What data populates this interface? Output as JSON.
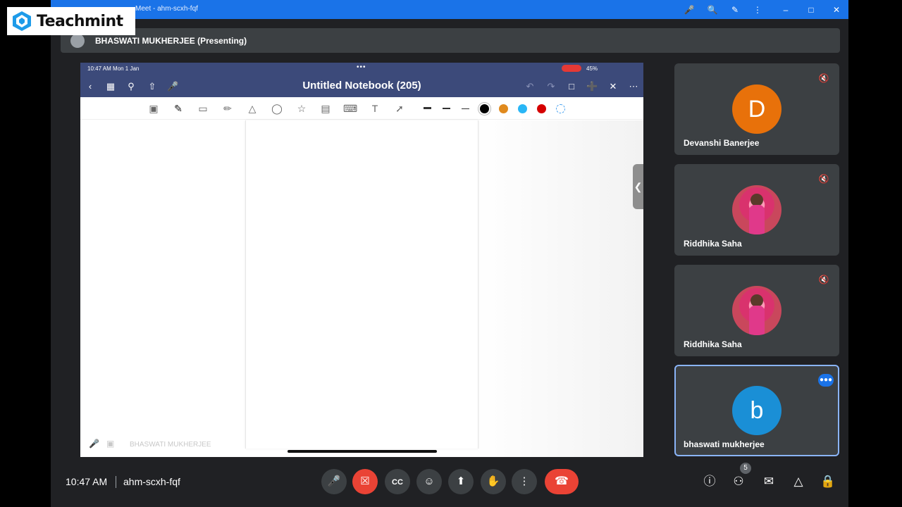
{
  "browser": {
    "title": "Meet - ahm-scxh-fqf"
  },
  "watermark": {
    "brand": "Teachmint"
  },
  "presenter": {
    "label": "BHASWATI MUKHERJEE (Presenting)"
  },
  "shared_screen": {
    "status_time": "10:47 AM  Mon 1 Jan",
    "battery": "45%",
    "notebook_title": "Untitled Notebook (205)",
    "footer_name": "BHASWATI MUKHERJEE",
    "colors": [
      "#000000",
      "#e08a1e",
      "#29b6f6",
      "#d50000"
    ]
  },
  "participants": [
    {
      "initial": "D",
      "name": "Devanshi Banerjee",
      "color": "#e8710a",
      "state": "muted"
    },
    {
      "initial": "",
      "name": "Riddhika Saha",
      "color": "#c9475c",
      "state": "muted"
    },
    {
      "initial": "",
      "name": "Riddhika Saha",
      "color": "#c9475c",
      "state": "muted"
    },
    {
      "initial": "b",
      "name": "bhaswati mukherjee",
      "color": "#1a8fd6",
      "state": "speaking"
    }
  ],
  "controls": {
    "time": "10:47 AM",
    "meeting_code": "ahm-scxh-fqf",
    "people_count": "5"
  }
}
